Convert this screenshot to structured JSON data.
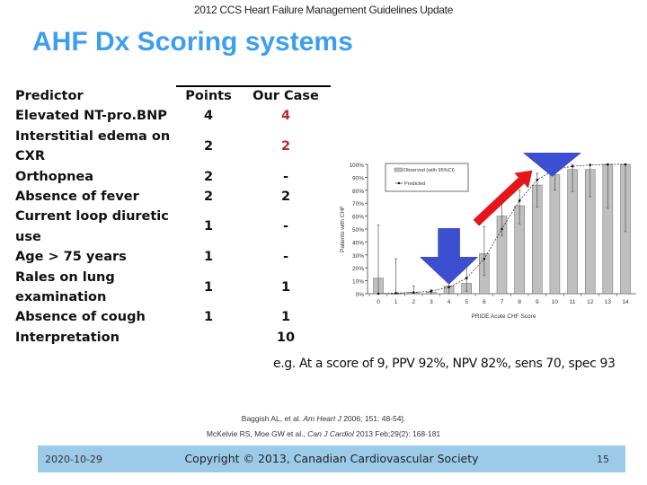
{
  "header": {
    "title": "2012 CCS Heart Failure Management Guidelines Update"
  },
  "slide": {
    "title": "AHF Dx Scoring systems"
  },
  "table": {
    "headers": {
      "predictor": "Predictor",
      "points": "Points",
      "our_case": "Our Case"
    },
    "rows": [
      {
        "predictor_lines": [
          "Elevated NT-pro.BNP"
        ],
        "points": "4",
        "our_case": "4",
        "highlight": true
      },
      {
        "predictor_lines": [
          "Interstitial edema on",
          "CXR"
        ],
        "points": "2",
        "our_case": "2",
        "highlight": true
      },
      {
        "predictor_lines": [
          "Orthopnea"
        ],
        "points": "2",
        "our_case": "-",
        "highlight": false
      },
      {
        "predictor_lines": [
          "Absence of fever"
        ],
        "points": "2",
        "our_case": "2",
        "highlight": false
      },
      {
        "predictor_lines": [
          "Current loop diuretic",
          "use"
        ],
        "points": "1",
        "our_case": "-",
        "highlight": false
      },
      {
        "predictor_lines": [
          "Age > 75 years"
        ],
        "points": "1",
        "our_case": "-",
        "highlight": false
      },
      {
        "predictor_lines": [
          "Rales on lung",
          "examination"
        ],
        "points": "1",
        "our_case": "1",
        "highlight": false
      },
      {
        "predictor_lines": [
          "Absence of cough"
        ],
        "points": "1",
        "our_case": "1",
        "highlight": false
      },
      {
        "predictor_lines": [
          "Interpretation"
        ],
        "points": "",
        "our_case": "10",
        "highlight": false
      }
    ],
    "highlight_color": "#c0282a"
  },
  "chart_data": {
    "type": "bar",
    "title": "",
    "xlabel": "PRIDE Acute CHF Score",
    "ylabel": "Patients with CHF",
    "categories": [
      "0",
      "1",
      "2",
      "3",
      "4",
      "5",
      "6",
      "7",
      "8",
      "9",
      "10",
      "11",
      "12",
      "13",
      "14"
    ],
    "ylim": [
      0,
      100
    ],
    "yticks": [
      "0%",
      "10%",
      "20%",
      "30%",
      "40%",
      "50%",
      "60%",
      "70%",
      "80%",
      "90%",
      "100%"
    ],
    "legend": {
      "position": "top-left",
      "entries": [
        "Observed (with 95%CI)",
        "Predicted"
      ]
    },
    "series": [
      {
        "name": "Observed (with 95%CI)",
        "kind": "bar",
        "values": [
          12,
          0,
          1,
          1,
          6,
          8,
          31,
          60,
          68,
          84,
          92,
          96,
          96,
          100,
          100
        ],
        "ci_low": [
          0,
          0,
          0,
          0,
          0,
          2,
          14,
          45,
          54,
          67,
          80,
          79,
          75,
          66,
          48
        ],
        "ci_high": [
          53,
          27,
          6,
          3,
          9,
          21,
          52,
          70,
          80,
          93,
          98,
          100,
          100,
          100,
          100
        ]
      },
      {
        "name": "Predicted",
        "kind": "line",
        "values": [
          0,
          0.5,
          1,
          2,
          5,
          12,
          27,
          50,
          72,
          88,
          96,
          98.5,
          99.5,
          100,
          100
        ]
      }
    ],
    "annotations": [
      {
        "type": "arrow-down",
        "color": "#3b4fd0",
        "at_category": "4"
      },
      {
        "type": "arrow-down",
        "color": "#3b4fd0",
        "at_category": "10"
      },
      {
        "type": "arrow-diagonal",
        "color": "#e8141c",
        "from_category": "6",
        "to_category": "9"
      }
    ],
    "bar_color": "#bfbfbf"
  },
  "note": "e.g. At a score of 9, PPV 92%, NPV 82%, sens 70, spec 93",
  "references": {
    "r1_prefix": "Baggish AL, et al. ",
    "r1_journal": "Am Heart J",
    "r1_suffix": " 2006; 151: 48-54].",
    "r2_prefix": "McKelvie RS, Moe GW et al., ",
    "r2_journal": "Can J Cardiol",
    "r2_suffix": " 2013 Feb;29(2): 168-181"
  },
  "footer": {
    "date": "2020-10-29",
    "copyright": "Copyright © 2013, Canadian Cardiovascular Society",
    "page": "15",
    "color": "#9ccbea"
  }
}
